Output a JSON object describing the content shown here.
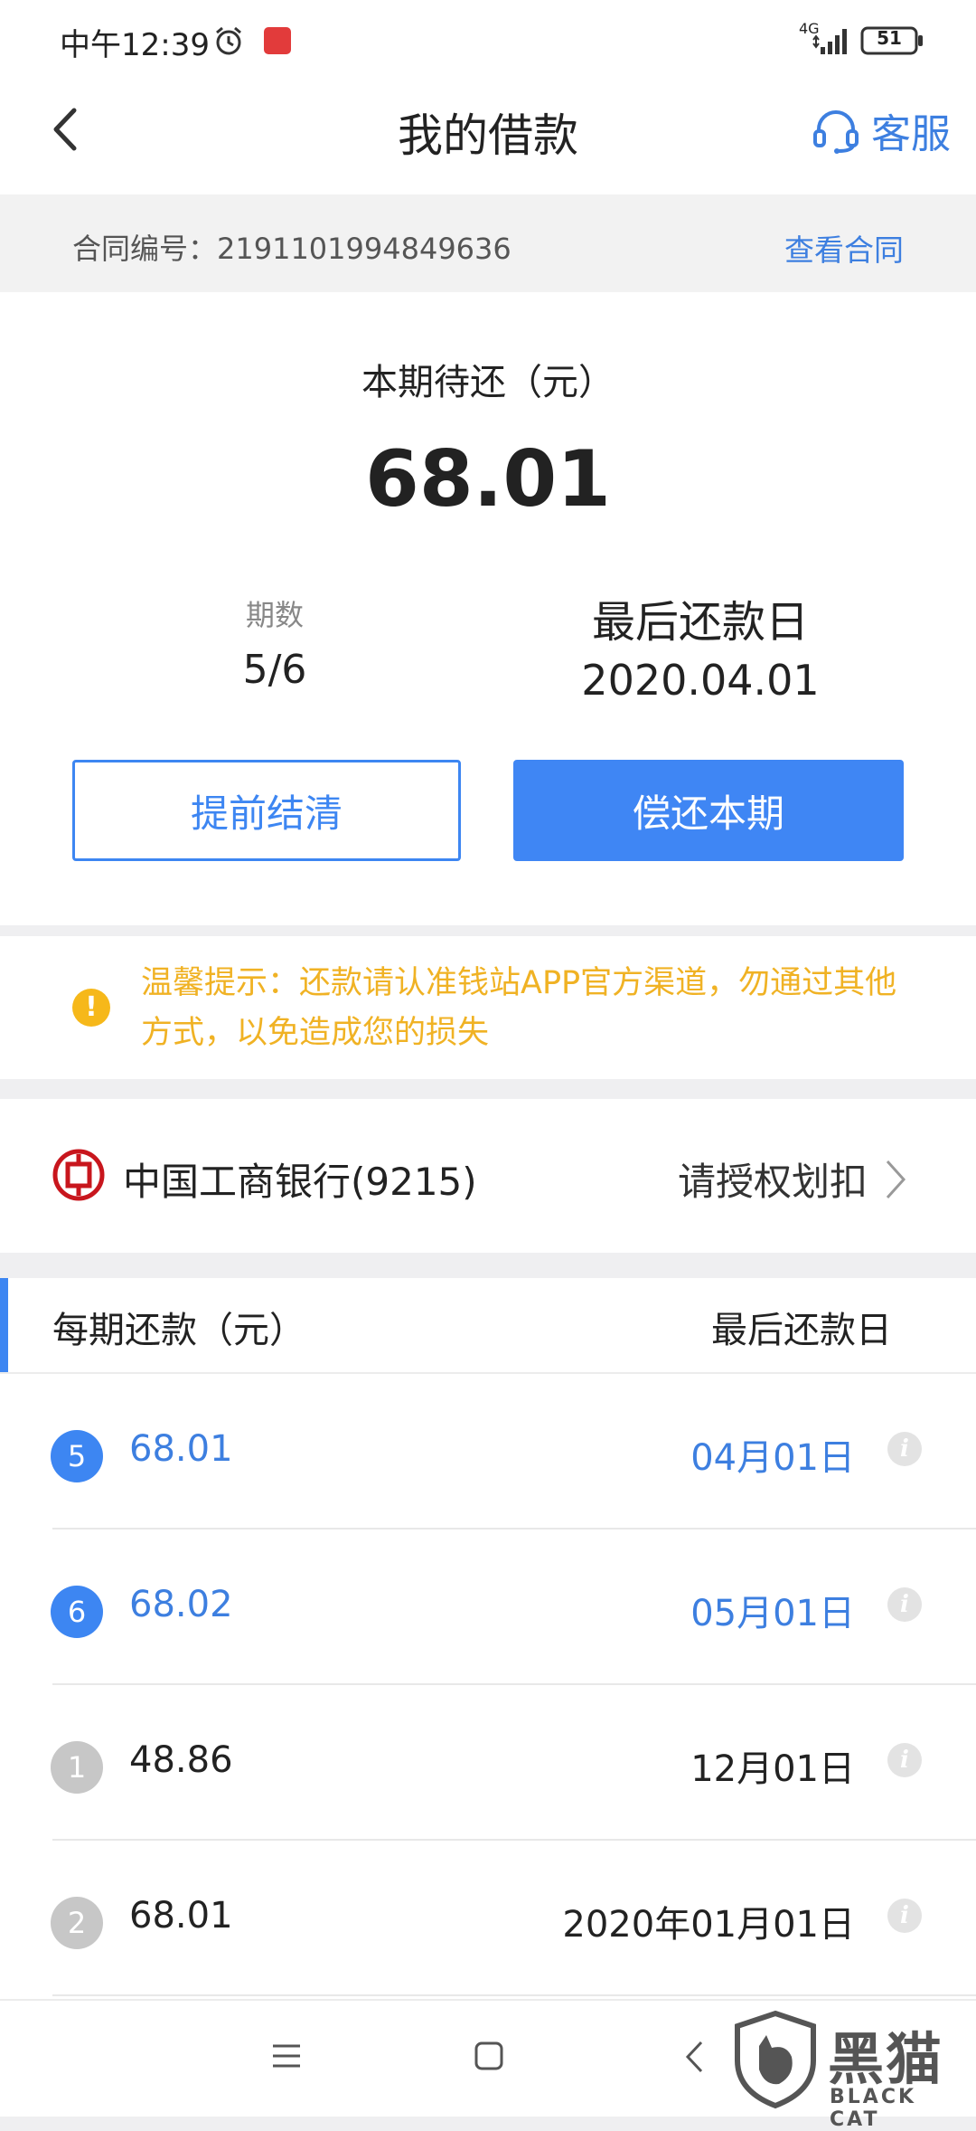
{
  "status_bar": {
    "time": "中午12:39",
    "network": "4G",
    "battery": "51"
  },
  "header": {
    "title": "我的借款",
    "service_label": "客服"
  },
  "contract": {
    "label": "合同编号：2191101994849636",
    "view_link": "查看合同"
  },
  "summary": {
    "due_label": "本期待还（元）",
    "due_amount": "68.01",
    "periods_label": "期数",
    "periods_value": "5/6",
    "last_date_label": "最后还款日",
    "last_date_value": "2020.04.01",
    "early_settle_button": "提前结清",
    "repay_button": "偿还本期"
  },
  "tip": {
    "text": "温馨提示：还款请认准钱站APP官方渠道，勿通过其他方式，以免造成您的损失"
  },
  "bank": {
    "name": "中国工商银行(9215)",
    "action": "请授权划扣"
  },
  "schedule": {
    "header_left": "每期还款（元）",
    "header_right": "最后还款日",
    "rows": [
      {
        "index": "5",
        "amount": "68.01",
        "date": "04月01日",
        "state": "active"
      },
      {
        "index": "6",
        "amount": "68.02",
        "date": "05月01日",
        "state": "active"
      },
      {
        "index": "1",
        "amount": "48.86",
        "date": "12月01日",
        "state": "inactive"
      },
      {
        "index": "2",
        "amount": "68.01",
        "date": "2020年01月01日",
        "state": "inactive"
      }
    ]
  },
  "watermark": {
    "title": "黑猫",
    "subtitle": "BLACK CAT"
  },
  "colors": {
    "accent": "#3d86f2",
    "warning": "#f0b224"
  }
}
